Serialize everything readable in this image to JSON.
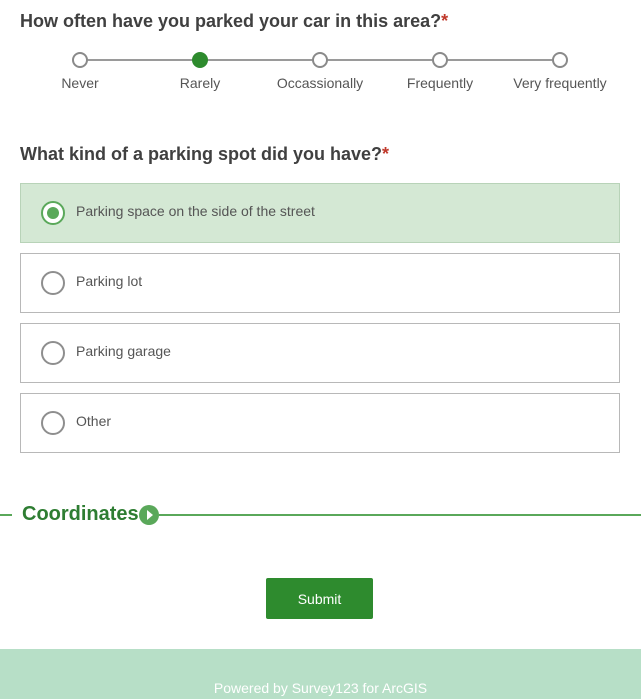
{
  "question1": {
    "title": "How often have you parked your car in this area?",
    "required_mark": "*",
    "options": [
      "Never",
      "Rarely",
      "Occassionally",
      "Frequently",
      "Very frequently"
    ],
    "selected": "Rarely"
  },
  "question2": {
    "title": "What kind of a parking spot did you have?",
    "required_mark": "*",
    "options": [
      "Parking space on the side of the street",
      "Parking lot",
      "Parking garage",
      "Other"
    ],
    "selected": "Parking space on the side of the street"
  },
  "section": {
    "title": "Coordinates",
    "expand_icon": "play-circle-icon"
  },
  "submit_label": "Submit",
  "footer": {
    "text": "Powered by Survey123 for ArcGIS"
  },
  "colors": {
    "accent": "#2e8b2e",
    "selected_bg": "#d4e8d4",
    "required": "#c0392b",
    "footer_bg": "#b7dfc7"
  }
}
